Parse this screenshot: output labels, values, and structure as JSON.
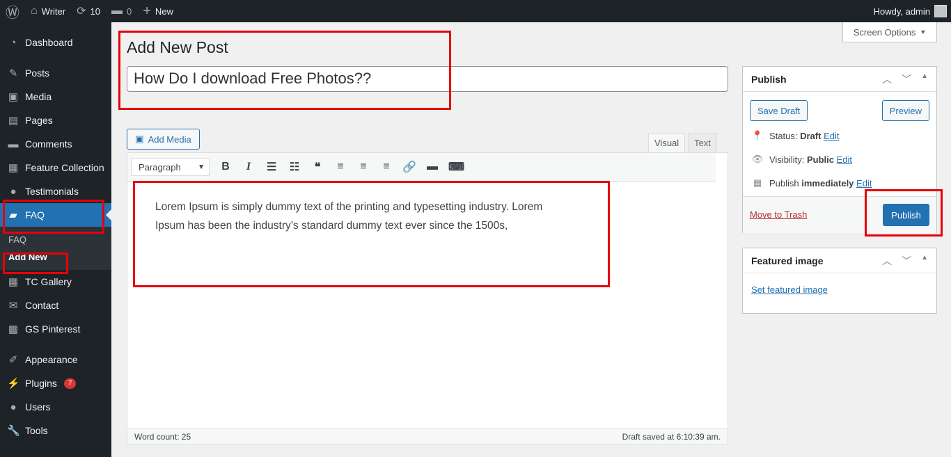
{
  "topbar": {
    "site": "Writer",
    "updates": "10",
    "comments": "0",
    "new": "New",
    "howdy": "Howdy, admin"
  },
  "sidebar": {
    "items": [
      {
        "label": "Dashboard",
        "icon": "dashboard-icon",
        "glyph": "◔"
      },
      {
        "label": "Posts",
        "icon": "pin-icon",
        "glyph": "✎"
      },
      {
        "label": "Media",
        "icon": "media-icon",
        "glyph": "▣"
      },
      {
        "label": "Pages",
        "icon": "pages-icon",
        "glyph": "▤"
      },
      {
        "label": "Comments",
        "icon": "comment-icon",
        "glyph": "▬"
      },
      {
        "label": "Feature Collection",
        "icon": "gallery-icon",
        "glyph": "▦"
      },
      {
        "label": "Testimonials",
        "icon": "person-icon",
        "glyph": "●"
      },
      {
        "label": "FAQ",
        "icon": "folder-icon",
        "glyph": "▰"
      }
    ],
    "submenu": [
      "FAQ",
      "Add New"
    ],
    "items2": [
      {
        "label": "TC Gallery",
        "icon": "gallery-icon",
        "glyph": "▦"
      },
      {
        "label": "Contact",
        "icon": "mail-icon",
        "glyph": "✉"
      },
      {
        "label": "GS Pinterest",
        "icon": "image-icon",
        "glyph": "▩"
      },
      {
        "label": "Appearance",
        "icon": "brush-icon",
        "glyph": "✐"
      },
      {
        "label": "Plugins",
        "icon": "plugin-icon",
        "glyph": "⚡",
        "badge": "7"
      },
      {
        "label": "Users",
        "icon": "users-icon",
        "glyph": "●"
      },
      {
        "label": "Tools",
        "icon": "wrench-icon",
        "glyph": "🔧"
      }
    ]
  },
  "screen_options": "Screen Options",
  "page_title": "Add New Post",
  "post_title": "How Do I download Free Photos??",
  "editor": {
    "add_media": "Add Media",
    "tab_visual": "Visual",
    "tab_text": "Text",
    "format": "Paragraph",
    "content": "Lorem Ipsum is simply dummy text of the printing and typesetting industry. Lorem Ipsum has been the industry’s standard dummy text ever since the 1500s,",
    "word_count": "Word count: 25",
    "saved": "Draft saved at 6:10:39 am."
  },
  "publish": {
    "title": "Publish",
    "save_draft": "Save Draft",
    "preview": "Preview",
    "status_label": "Status:",
    "status": "Draft",
    "visibility_label": "Visibility:",
    "visibility": "Public",
    "publish_label": "Publish",
    "publish_when": "immediately",
    "edit": "Edit",
    "trash": "Move to Trash",
    "publish_btn": "Publish"
  },
  "featured": {
    "title": "Featured image",
    "set": "Set featured image"
  },
  "colors": {
    "accent": "#2271b1",
    "admin_bar": "#1d2327",
    "highlight_box": "#e8000b"
  }
}
